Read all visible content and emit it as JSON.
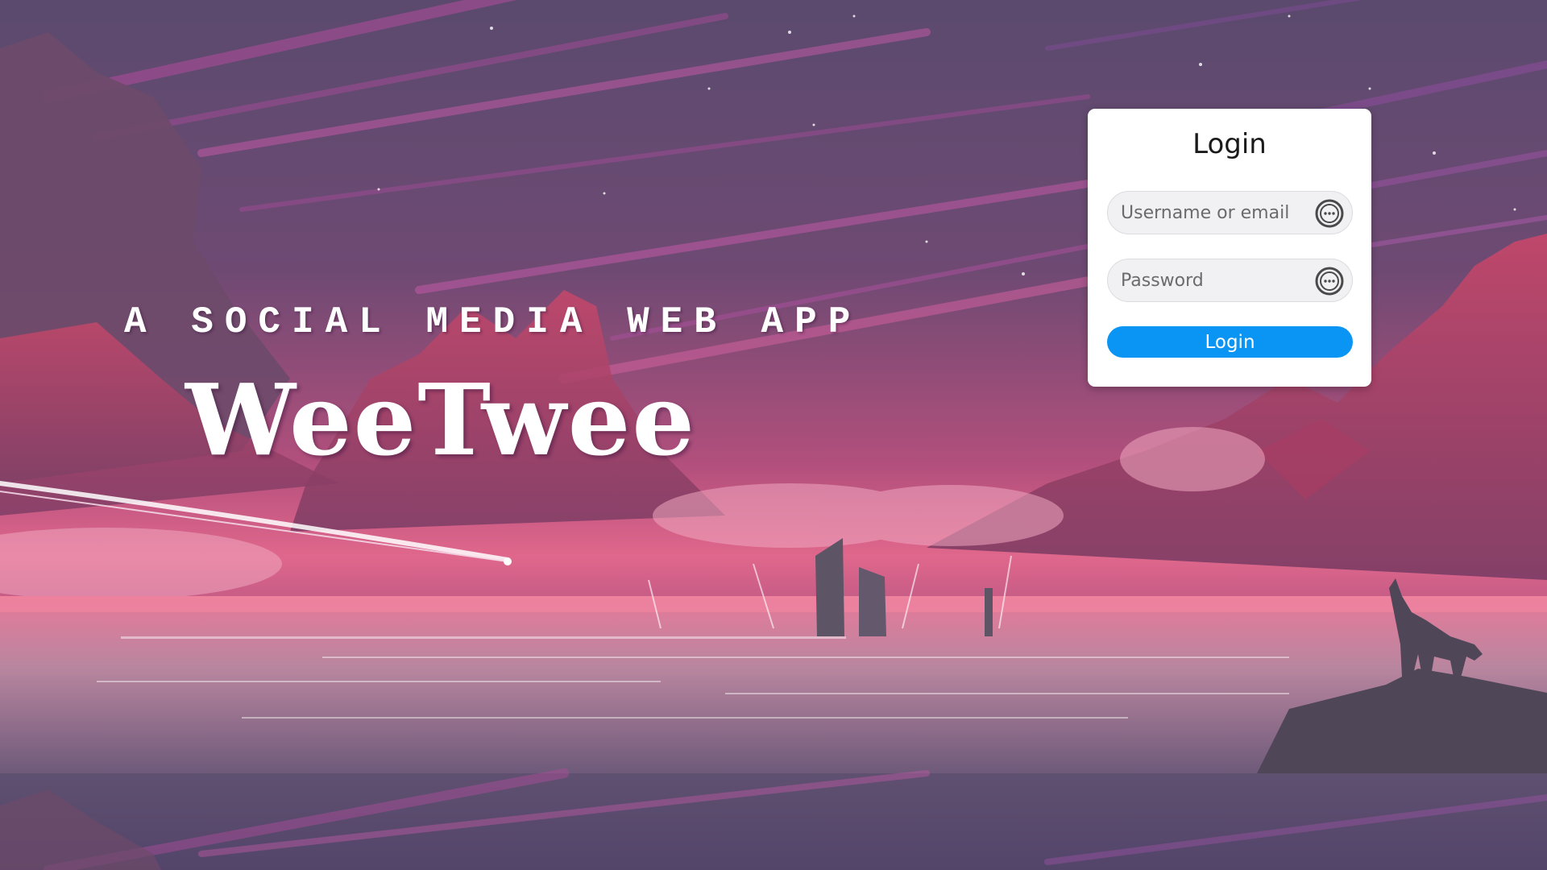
{
  "hero": {
    "tagline": "A SOCIAL MEDIA WEB APP",
    "brand": "WeeTwee"
  },
  "login": {
    "title": "Login",
    "username_placeholder": "Username or email",
    "password_placeholder": "Password",
    "username_icon": "chat-bubble-icon",
    "password_icon": "chat-bubble-icon",
    "submit_label": "Login"
  },
  "colors": {
    "accent": "#0a95f5",
    "card": "#ffffff",
    "sky_top": "#5b4a6e",
    "sky_pink": "#d8517c"
  }
}
